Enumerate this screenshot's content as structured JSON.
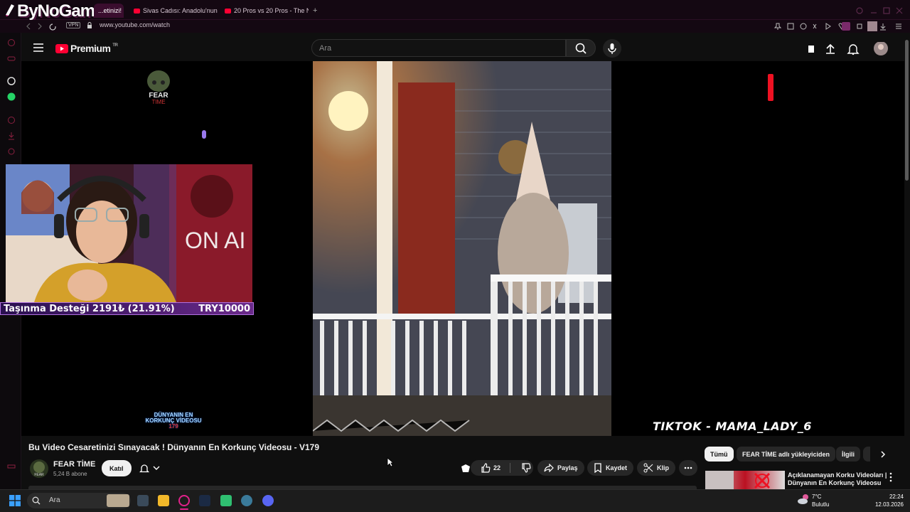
{
  "browser": {
    "logo": "ByNoGame",
    "tabs": [
      {
        "label": "...etinizi!"
      },
      {
        "label": "Sivas Cadısı: Anadolu'nun"
      },
      {
        "label": "20 Pros vs 20 Pros - The N"
      }
    ],
    "url": "www.youtube.com/watch",
    "vpn": "VPN"
  },
  "youtube": {
    "brand": "Premium",
    "country": "TR",
    "search_placeholder": "Ara"
  },
  "video": {
    "watermark_credit": "TIKTOK - MAMA_LADY_6",
    "overlay_logo_word1": "FEAR",
    "overlay_logo_word2": "TIME",
    "overlay_wm_line1": "DÜNYANIN EN",
    "overlay_wm_line2": "KORKUNÇ VİDEOSU",
    "overlay_wm_line3": "179"
  },
  "stream_overlay": {
    "donation_left": "Taşınma Desteği 2191₺ (21.91%)",
    "donation_right": "TRY10000",
    "donation_progress": 0.2191
  },
  "details": {
    "title": "Bu Video Cesaretinizi Sınayacak ! Dünyanın En Korkunç Videosu - V179",
    "channel": "FEAR TİME",
    "subscribers": "5,24 B abone",
    "join_label": "Katıl",
    "likes": "22",
    "share_label": "Paylaş",
    "save_label": "Kaydet",
    "clip_label": "Klip"
  },
  "sidebar_chips": [
    {
      "label": "Tümü"
    },
    {
      "label": "FEAR TİME adlı yükleyiciden"
    },
    {
      "label": "İlgili"
    }
  ],
  "recommendation": {
    "title": "Açıklanamayan Korku Videoları | Dünyanın En Korkunç Videosu ..."
  },
  "taskbar": {
    "search": "Ara",
    "weather_temp": "7°C",
    "weather_desc": "Bulutlu",
    "time": "22:24",
    "date": "12.03.2026"
  },
  "colors": {
    "browser_accent": "#e0218a",
    "youtube_red": "#ff0033",
    "donation_bar": "#6a2a8a"
  }
}
